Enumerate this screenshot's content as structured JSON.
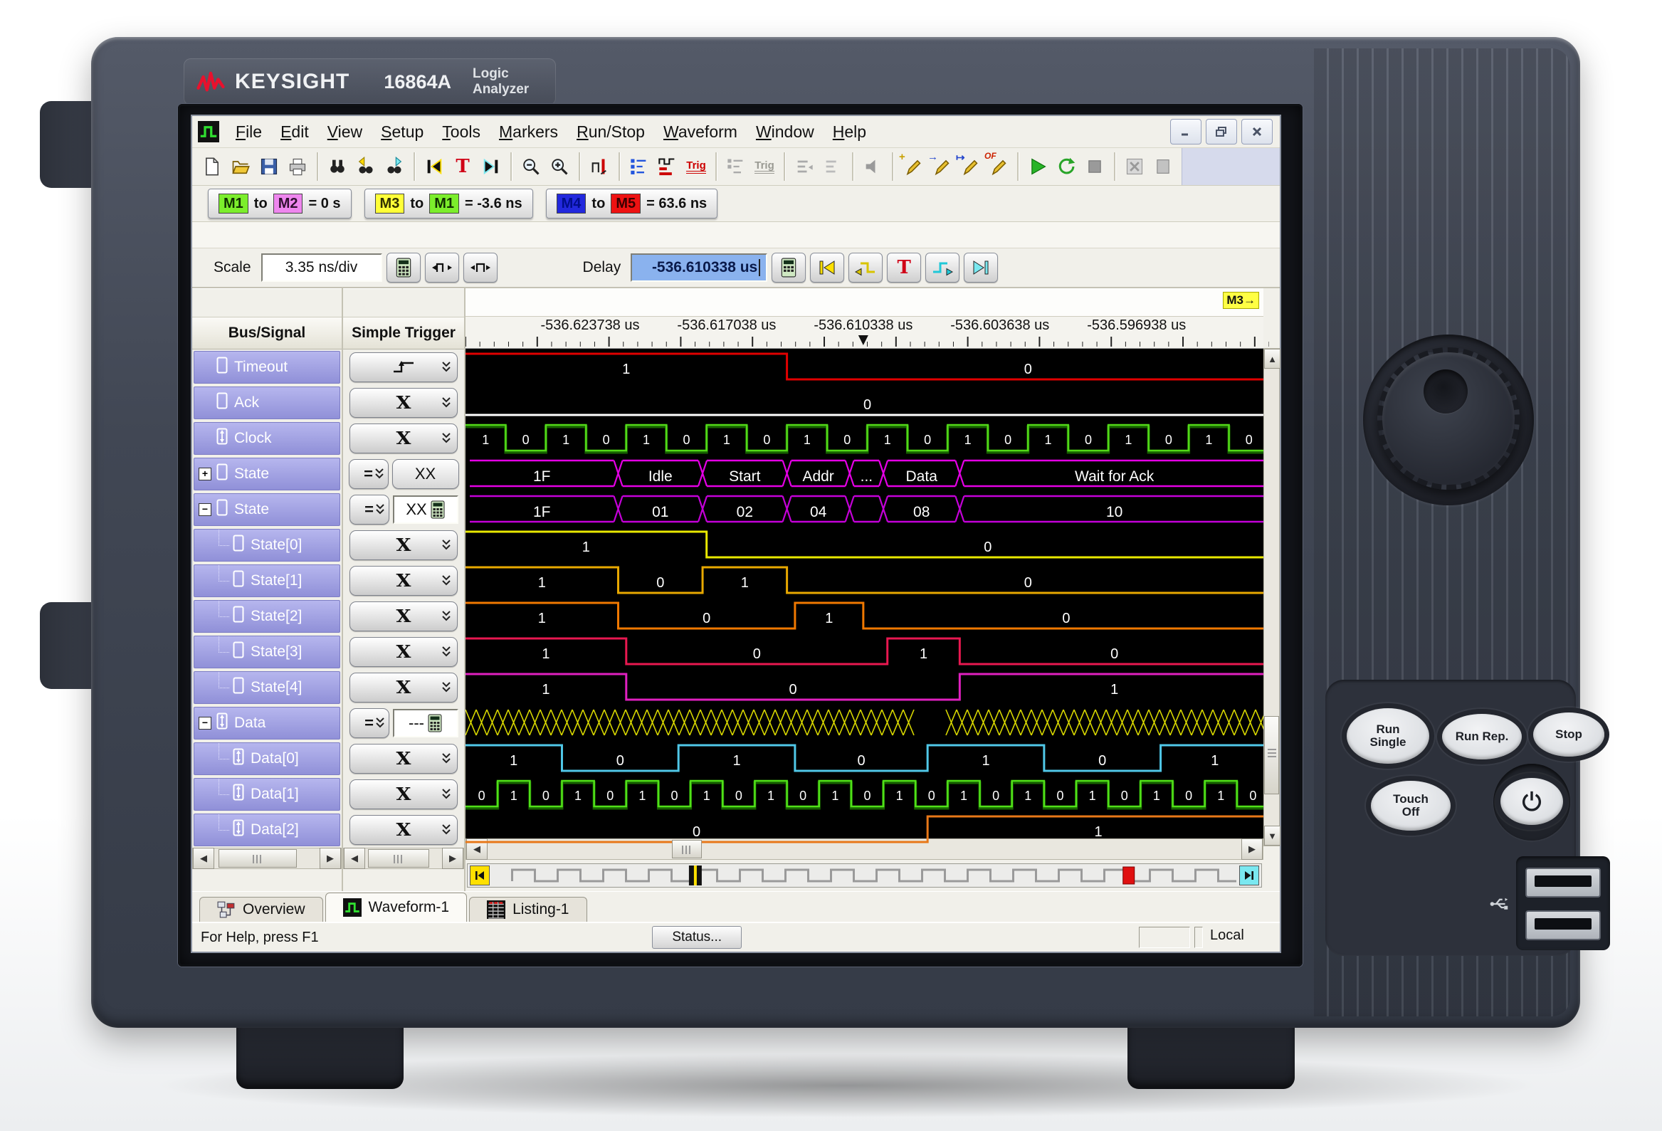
{
  "device": {
    "brand": "KEYSIGHT",
    "model": "16864A",
    "product": "Logic Analyzer",
    "hw_buttons": {
      "run_single": [
        "Run",
        "Single"
      ],
      "run_rep": "Run Rep.",
      "stop": "Stop",
      "touch_off": [
        "Touch",
        "Off"
      ]
    }
  },
  "window": {
    "menu": [
      "File",
      "Edit",
      "View",
      "Setup",
      "Tools",
      "Markers",
      "Run/Stop",
      "Waveform",
      "Window",
      "Help"
    ]
  },
  "toolbar": {
    "trig_label": "Trig",
    "trig_disabled_label": "Trig",
    "of_label": "OF"
  },
  "marker_bar": [
    {
      "a": "M1",
      "a_color": "#7cee2c",
      "a_text": "#103000",
      "b": "M2",
      "b_color": "#ee86ee",
      "b_text": "#301030",
      "to": "to",
      "value": "= 0 s"
    },
    {
      "a": "M3",
      "a_color": "#ffff38",
      "a_text": "#303000",
      "b": "M1",
      "b_color": "#7cee2c",
      "b_text": "#103000",
      "to": "to",
      "value": "= -3.6 ns"
    },
    {
      "a": "M4",
      "a_color": "#2228dd",
      "a_text": "#000e8a",
      "b": "M5",
      "b_color": "#ee1212",
      "b_text": "#3a0000",
      "to": "to",
      "value": "= 63.6 ns"
    }
  ],
  "scale": {
    "label": "Scale",
    "value": "3.35 ns/div"
  },
  "delay": {
    "label": "Delay",
    "value": "-536.610338 us"
  },
  "columns": {
    "bus_signal": "Bus/Signal",
    "simple_trigger": "Simple Trigger"
  },
  "ruler": {
    "labels": [
      "-536.623738 us",
      "-536.617038 us",
      "-536.610338 us",
      "-536.603638 us",
      "-536.596938 us"
    ],
    "centers": [
      0.155,
      0.325,
      0.495,
      0.665,
      0.835
    ],
    "corner_marker": "M3→",
    "trigger_pos": 0.495
  },
  "signals": [
    {
      "name": "Timeout",
      "icon": "sig",
      "indent": 0,
      "trigger": {
        "kind": "edge"
      },
      "wave": {
        "type": "binary",
        "color": "#e10000",
        "edges": [
          0.4
        ],
        "labels": [
          "1",
          "0"
        ],
        "start_high": true
      }
    },
    {
      "name": "Ack",
      "icon": "sig",
      "indent": 0,
      "trigger": {
        "kind": "x"
      },
      "wave": {
        "type": "binary",
        "color": "#ffffff",
        "edges": [],
        "labels": [
          "0"
        ],
        "start_high": false
      }
    },
    {
      "name": "Clock",
      "icon": "io",
      "indent": 0,
      "trigger": {
        "kind": "x"
      },
      "wave": {
        "type": "clock",
        "color": "#52d818",
        "shadow": "#1d7a00",
        "pattern": "10101010101010101010"
      }
    },
    {
      "name": "State",
      "icon": "sig",
      "indent": 0,
      "expand": "+",
      "trigger": {
        "kind": "eq_btn",
        "value": "XX"
      },
      "wave": {
        "type": "bus",
        "color": "#e400e4",
        "segments": [
          {
            "label": "1F",
            "end": 0.19
          },
          {
            "label": "Idle",
            "end": 0.295
          },
          {
            "label": "Start",
            "end": 0.4
          },
          {
            "label": "Addr",
            "end": 0.478
          },
          {
            "label": "...",
            "end": 0.52
          },
          {
            "label": "Data",
            "end": 0.615
          },
          {
            "label": "Wait for Ack",
            "end": 1
          }
        ]
      }
    },
    {
      "name": "State",
      "icon": "sig",
      "indent": 0,
      "expand": "−",
      "trigger": {
        "kind": "eq_input",
        "value": "XX"
      },
      "wave": {
        "type": "bus",
        "color": "#c400d8",
        "segments": [
          {
            "label": "1F",
            "end": 0.19
          },
          {
            "label": "01",
            "end": 0.295
          },
          {
            "label": "02",
            "end": 0.4
          },
          {
            "label": "04",
            "end": 0.478
          },
          {
            "label": "",
            "end": 0.52
          },
          {
            "label": "08",
            "end": 0.615
          },
          {
            "label": "10",
            "end": 1
          }
        ]
      }
    },
    {
      "name": "State[0]",
      "icon": "sig",
      "indent": 1,
      "trigger": {
        "kind": "x"
      },
      "wave": {
        "type": "binary",
        "color": "#e8e800",
        "edges": [
          0.3
        ],
        "labels": [
          "1",
          "0"
        ],
        "start_high": true
      }
    },
    {
      "name": "State[1]",
      "icon": "sig",
      "indent": 1,
      "trigger": {
        "kind": "x"
      },
      "wave": {
        "type": "binary",
        "color": "#e8a800",
        "edges": [
          0.19,
          0.295,
          0.4
        ],
        "labels": [
          "1",
          "0",
          "1",
          "0"
        ],
        "start_high": true
      }
    },
    {
      "name": "State[2]",
      "icon": "sig",
      "indent": 1,
      "trigger": {
        "kind": "x"
      },
      "wave": {
        "type": "binary",
        "color": "#f07800",
        "edges": [
          0.19,
          0.41,
          0.495
        ],
        "labels": [
          "1",
          "0",
          "1",
          "0"
        ],
        "start_high": true
      }
    },
    {
      "name": "State[3]",
      "icon": "sig",
      "indent": 1,
      "trigger": {
        "kind": "x"
      },
      "wave": {
        "type": "binary",
        "color": "#e81850",
        "edges": [
          0.2,
          0.525,
          0.615
        ],
        "labels": [
          "1",
          "0",
          "1",
          "0"
        ],
        "start_high": true
      }
    },
    {
      "name": "State[4]",
      "icon": "sig",
      "indent": 1,
      "trigger": {
        "kind": "x"
      },
      "wave": {
        "type": "binary",
        "color": "#e020c0",
        "edges": [
          0.2,
          0.615
        ],
        "labels": [
          "1",
          "0",
          "1"
        ],
        "start_high": true
      }
    },
    {
      "name": "Data",
      "icon": "io",
      "indent": 0,
      "expand": "−",
      "trigger": {
        "kind": "eq_input",
        "value": "---"
      },
      "wave": {
        "type": "busy",
        "color": "#d8d800",
        "gap": [
          0.565,
          0.585
        ]
      }
    },
    {
      "name": "Data[0]",
      "icon": "io",
      "indent": 1,
      "trigger": {
        "kind": "x"
      },
      "wave": {
        "type": "binary",
        "color": "#50c8e8",
        "edges": [
          0.12,
          0.265,
          0.41,
          0.575,
          0.72,
          0.865
        ],
        "labels": [
          "1",
          "0",
          "1",
          "0",
          "1",
          "0",
          "1"
        ],
        "start_high": true
      }
    },
    {
      "name": "Data[1]",
      "icon": "io",
      "indent": 1,
      "trigger": {
        "kind": "x"
      },
      "wave": {
        "type": "clock",
        "color": "#50e018",
        "shadow": "#1d7a00",
        "pattern": "0101010101010101010101010"
      }
    },
    {
      "name": "Data[2]",
      "icon": "io",
      "indent": 1,
      "trigger": {
        "kind": "x"
      },
      "wave": {
        "type": "binary",
        "color": "#e87818",
        "edges": [
          0.575
        ],
        "labels": [
          "0",
          "1"
        ],
        "start_high": false
      }
    }
  ],
  "navbar": {
    "cursor_pos": 0.26,
    "trigger_pos": 0.875
  },
  "tabs": [
    {
      "label": "Overview",
      "icon": "overview",
      "active": false
    },
    {
      "label": "Waveform-1",
      "icon": "waveform",
      "active": true
    },
    {
      "label": "Listing-1",
      "icon": "listing",
      "active": false
    }
  ],
  "status": {
    "help": "For Help, press F1",
    "status_btn": "Status...",
    "mode": "Local"
  }
}
